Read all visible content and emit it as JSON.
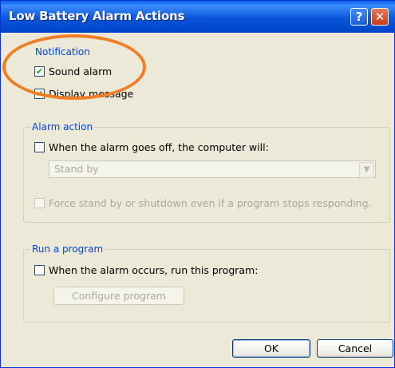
{
  "window": {
    "title": "Low Battery Alarm Actions",
    "help_glyph": "?",
    "close_glyph": "✕"
  },
  "notification": {
    "legend": "Notification",
    "sound_alarm": {
      "label": "Sound alarm",
      "checked": true
    },
    "display_message": {
      "label": "Display message",
      "checked": true
    }
  },
  "alarm_action": {
    "legend": "Alarm action",
    "when_alarm": {
      "label": "When the alarm goes off, the computer will:",
      "checked": false
    },
    "action_select": {
      "value": "Stand by",
      "enabled": false
    },
    "force": {
      "label": "Force stand by or shutdown even if a program stops responding.",
      "checked": false,
      "enabled": false
    }
  },
  "run_program": {
    "legend": "Run a program",
    "when_alarm": {
      "label": "When the alarm occurs, run this program:",
      "checked": false
    },
    "configure_button": {
      "label": "Configure program",
      "enabled": false
    }
  },
  "buttons": {
    "ok": "OK",
    "cancel": "Cancel"
  },
  "colors": {
    "title_bar": "#0a55d8",
    "legend_text": "#0046d5",
    "highlight": "#f07e27",
    "dialog_bg": "#ece9d8"
  },
  "annotation": {
    "shape": "ellipse",
    "marks": "notification-group"
  }
}
